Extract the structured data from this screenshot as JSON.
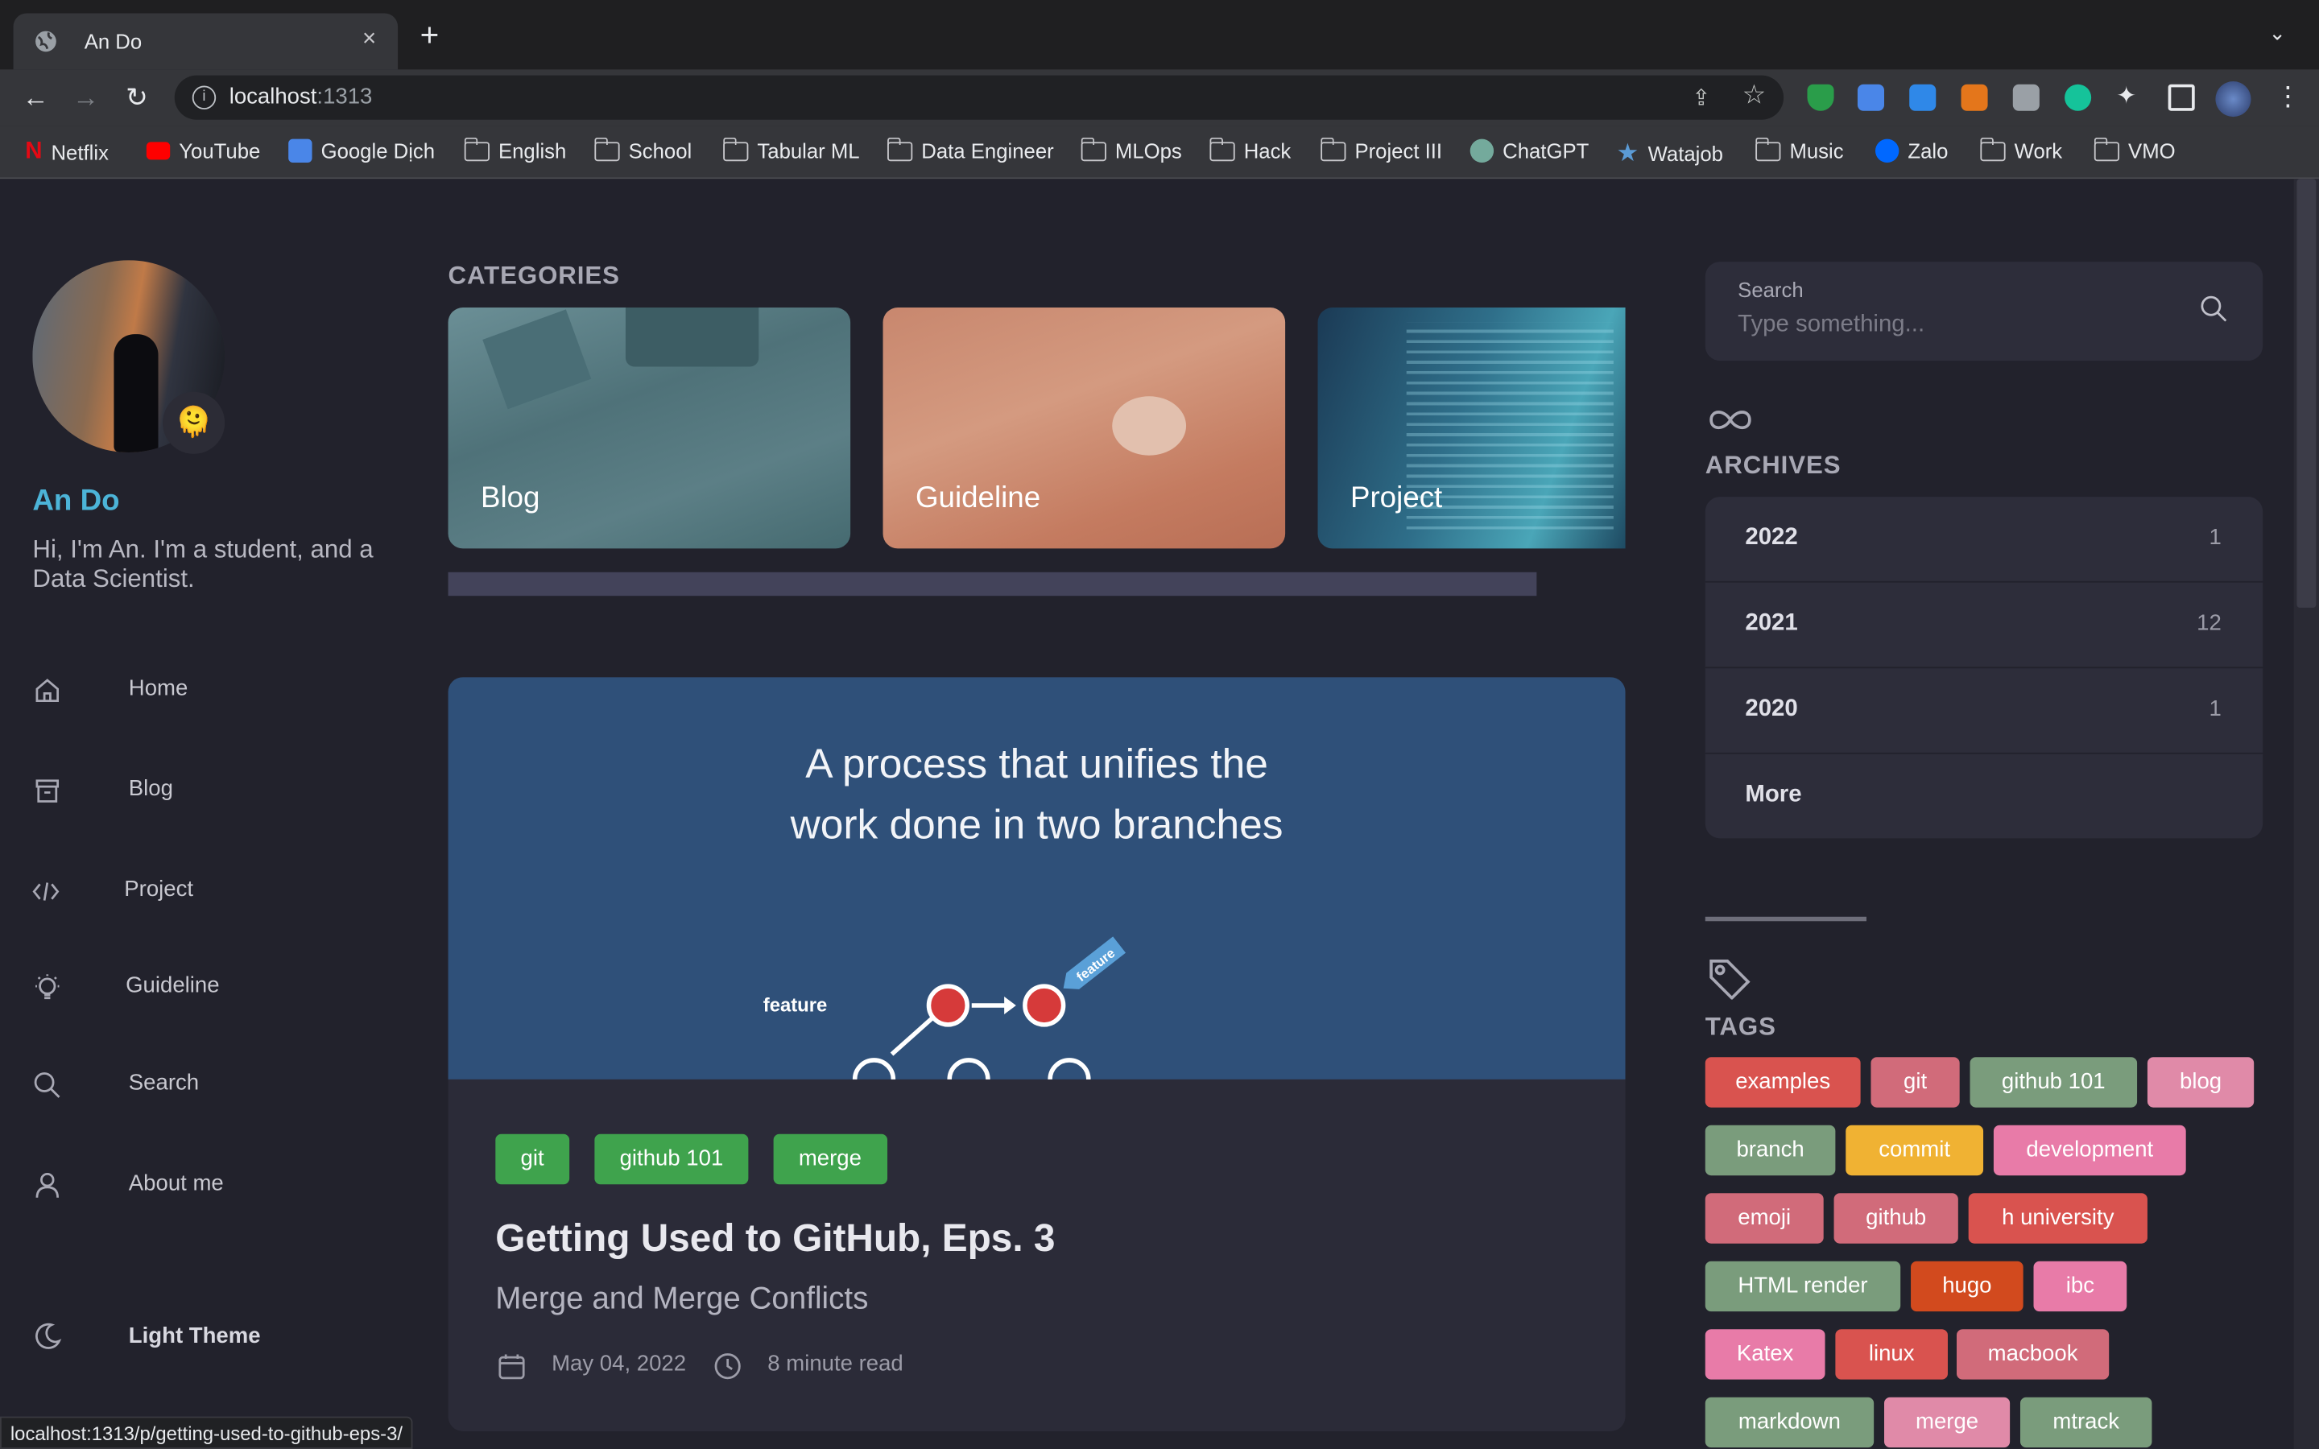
{
  "browser": {
    "tab_title": "An Do",
    "close_glyph": "×",
    "new_tab_glyph": "+",
    "tab_list_glyph": "⌄",
    "back_glyph": "←",
    "forward_glyph": "→",
    "reload_glyph": "↻",
    "url_host": "localhost",
    "url_port": ":1313",
    "bookmarks": [
      "Netflix",
      "YouTube",
      "Google Dịch",
      "English",
      "School",
      "Tabular ML",
      "Data Engineer",
      "MLOps",
      "Hack",
      "Project III",
      "ChatGPT",
      "Watajob",
      "Music",
      "Zalo",
      "Work",
      "VMO"
    ],
    "status_url": "localhost:1313/p/getting-used-to-github-eps-3/"
  },
  "profile": {
    "name": "An Do",
    "bio": "Hi, I'm An. I'm a student, and a Data Scientist.",
    "emoji": "🫠"
  },
  "menu": {
    "items": [
      "Home",
      "Blog",
      "Project",
      "Guideline",
      "Search",
      "About me"
    ],
    "theme_label": "Light Theme"
  },
  "categories": {
    "heading": "CATEGORIES",
    "items": [
      "Blog",
      "Guideline",
      "Project"
    ]
  },
  "post": {
    "hero_line1": "A process that unifies the",
    "hero_line2": "work done in two branches",
    "diagram_branch_label": "feature",
    "diagram_flag_label": "feature",
    "tags": [
      "git",
      "github 101",
      "merge"
    ],
    "title": "Getting Used to GitHub, Eps. 3",
    "subtitle": "Merge and Merge Conflicts",
    "date": "May 04, 2022",
    "read_time": "8 minute read"
  },
  "search": {
    "label": "Search",
    "placeholder": "Type something..."
  },
  "archives": {
    "heading": "ARCHIVES",
    "rows": [
      {
        "year": "2022",
        "count": "1"
      },
      {
        "year": "2021",
        "count": "12"
      },
      {
        "year": "2020",
        "count": "1"
      }
    ],
    "more": "More"
  },
  "tags": {
    "heading": "TAGS",
    "items": [
      "examples",
      "git",
      "github 101",
      "blog",
      "branch",
      "commit",
      "development",
      "emoji",
      "github",
      "h university",
      "HTML render",
      "hugo",
      "ibc",
      "Katex",
      "linux",
      "macbook",
      "markdown",
      "merge",
      "mtrack"
    ]
  },
  "colors": {
    "accent": "#4cb4d8",
    "post_tag": "#3fa34d",
    "hero_bg": "#2f5079"
  }
}
